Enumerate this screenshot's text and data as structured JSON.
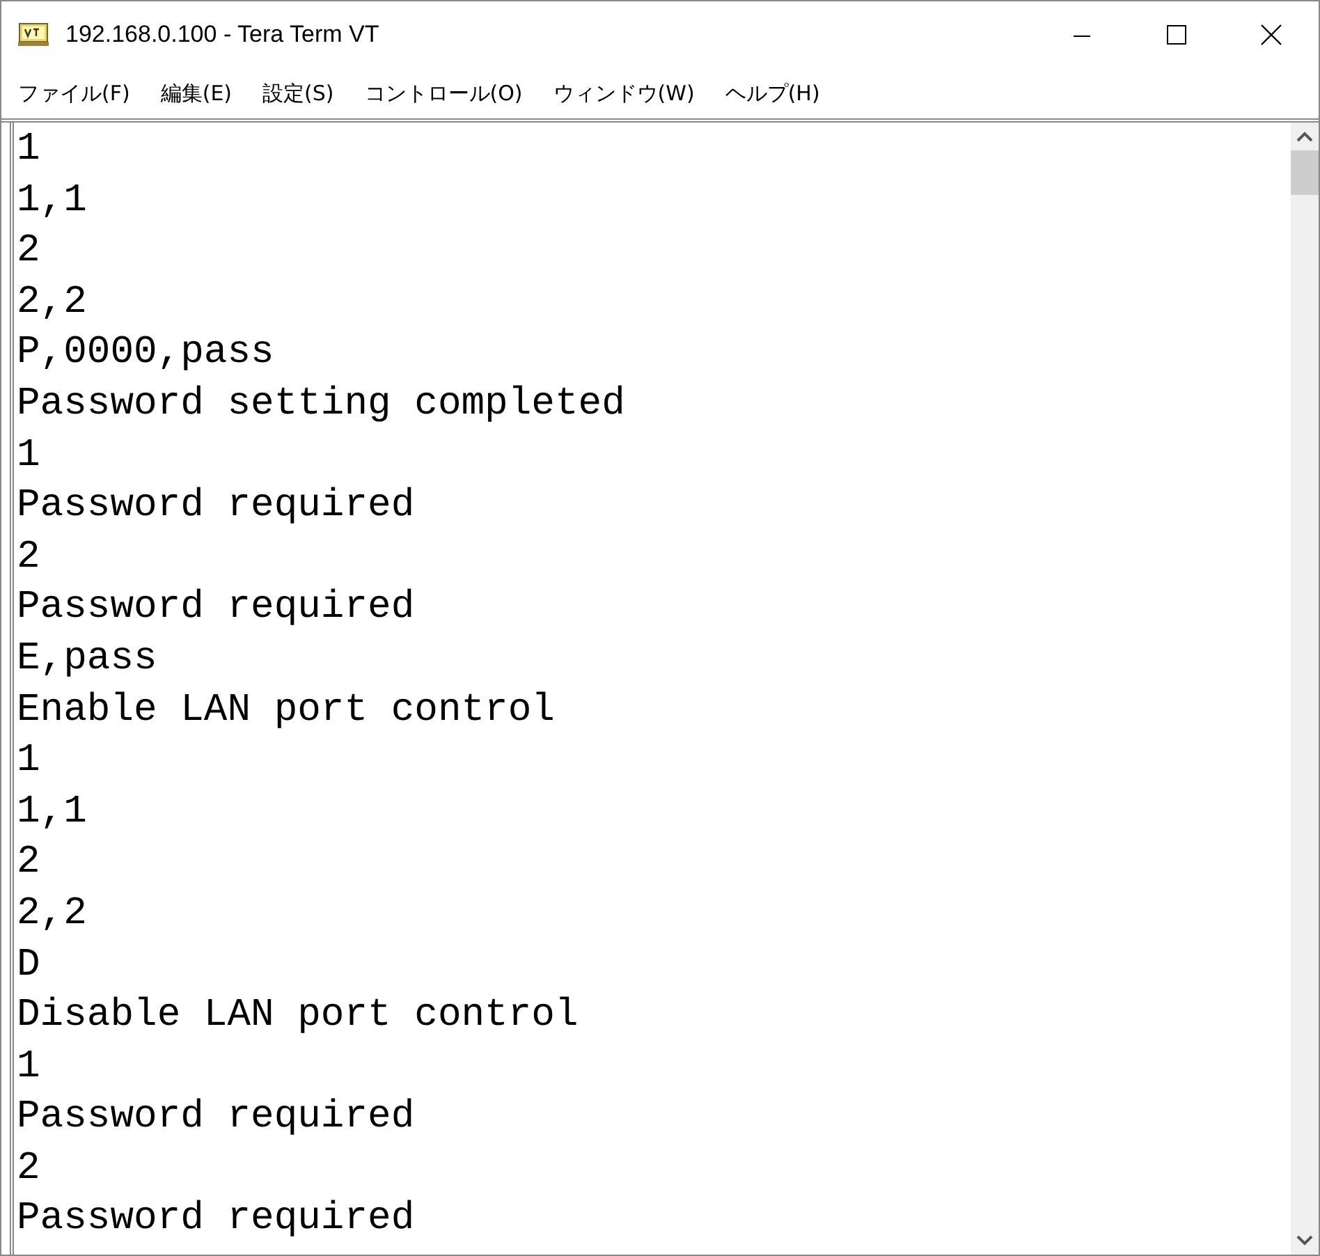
{
  "window": {
    "title": "192.168.0.100 - Tera Term VT"
  },
  "menu": [
    {
      "label": "ファイル(F)"
    },
    {
      "label": "編集(E)"
    },
    {
      "label": "設定(S)"
    },
    {
      "label": "コントロール(O)"
    },
    {
      "label": "ウィンドウ(W)"
    },
    {
      "label": "ヘルプ(H)"
    }
  ],
  "terminal_lines": [
    "1",
    "1,1",
    "2",
    "2,2",
    "P,0000,pass",
    "Password setting completed",
    "1",
    "Password required",
    "2",
    "Password required",
    "E,pass",
    "Enable LAN port control",
    "1",
    "1,1",
    "2",
    "2,2",
    "D",
    "Disable LAN port control",
    "1",
    "Password required",
    "2",
    "Password required"
  ]
}
